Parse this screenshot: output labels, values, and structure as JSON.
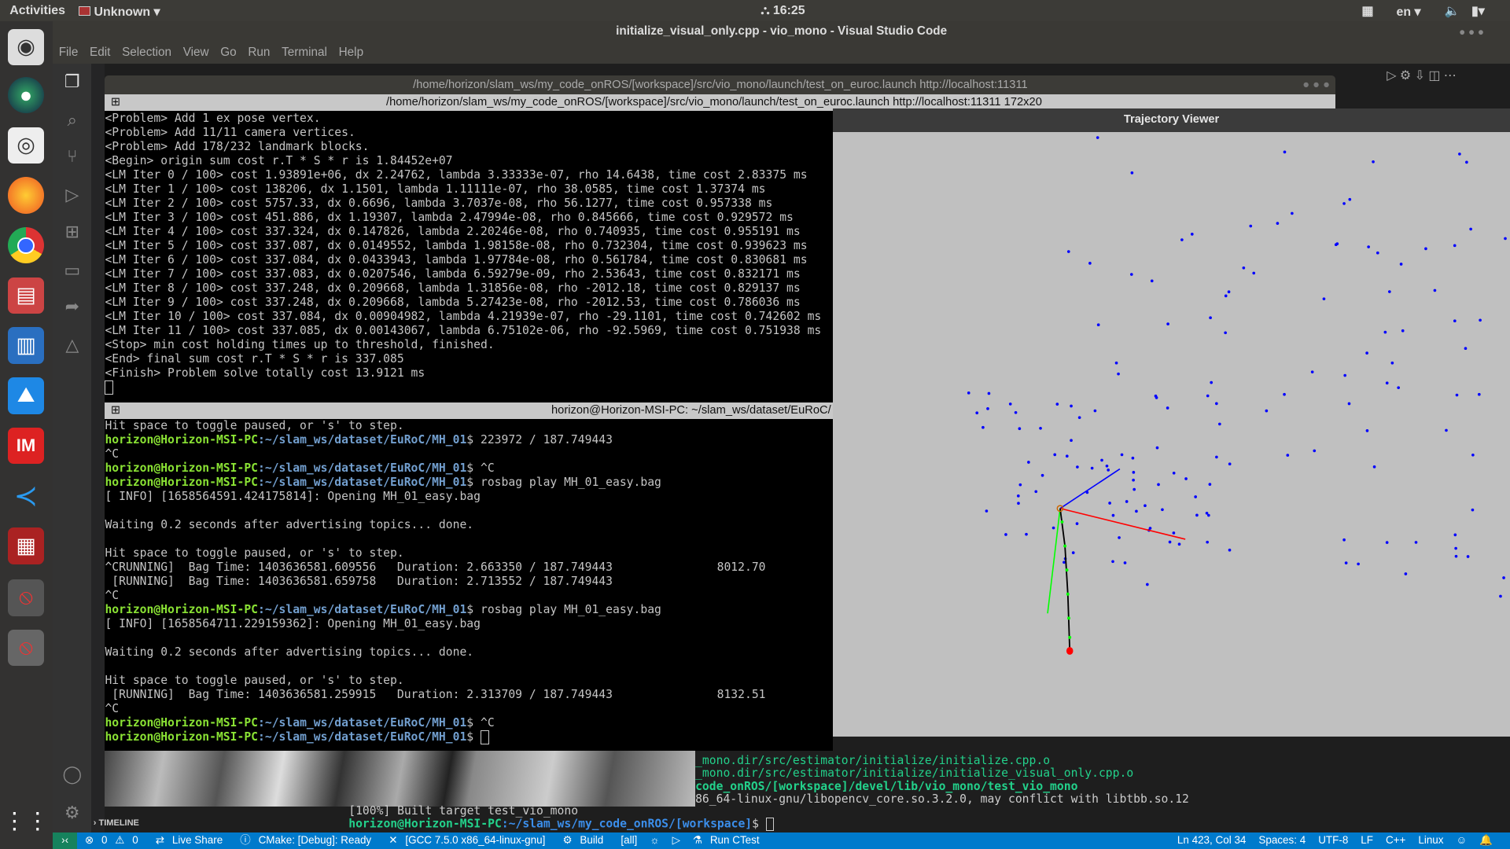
{
  "topbar": {
    "activities": "Activities",
    "app": "Unknown",
    "clock": "16:25",
    "lang": "en"
  },
  "vscode": {
    "title": "initialize_visual_only.cpp - vio_mono - Visual Studio Code",
    "menu": [
      "File",
      "Edit",
      "Selection",
      "View",
      "Go",
      "Run",
      "Terminal",
      "Help"
    ],
    "timeline": "TIMELINE",
    "terminal_lines": [
      {
        "text": "_mono.dir/src/estimator/initialize/initialize.cpp.o",
        "cls": "g"
      },
      {
        "text": "_mono.dir/src/estimator/initialize/initialize_visual_only.cpp.o",
        "cls": "g"
      },
      {
        "text": "code_onROS/[workspace]/devel/lib/vio_mono/test_vio_mono",
        "cls": "gb"
      },
      {
        "text": "86_64-linux-gnu/libopencv_core.so.3.2.0, may conflict with libtbb.so.12",
        "cls": ""
      }
    ],
    "built": "[100%] Built target test_vio_mono",
    "prompt_user": "horizon@Horizon-MSI-PC",
    "prompt_path": ":~/slam_ws/my_code_onROS/[workspace]",
    "prompt_end": "$ "
  },
  "terminator": {
    "window_title": "/home/horizon/slam_ws/my_code_onROS/[workspace]/src/vio_mono/launch/test_on_euroc.launch http://localhost:11311",
    "upper_title": "/home/horizon/slam_ws/my_code_onROS/[workspace]/src/vio_mono/launch/test_on_euroc.launch http://localhost:11311 172x20",
    "lower_title": "horizon@Horizon-MSI-PC: ~/slam_ws/dataset/EuRoC/",
    "upper_lines": [
      "<Problem> Add 1 ex pose vertex.",
      "<Problem> Add 11/11 camera vertices.",
      "<Problem> Add 178/232 landmark blocks.",
      "<Begin> origin sum cost r.T * S * r is 1.84452e+07",
      "<LM Iter 0 / 100> cost 1.93891e+06, dx 2.24762, lambda 3.33333e-07, rho 14.6438, time cost 2.83375 ms",
      "<LM Iter 1 / 100> cost 138206, dx 1.1501, lambda 1.11111e-07, rho 38.0585, time cost 1.37374 ms",
      "<LM Iter 2 / 100> cost 5757.33, dx 0.6696, lambda 3.7037e-08, rho 56.1277, time cost 0.957338 ms",
      "<LM Iter 3 / 100> cost 451.886, dx 1.19307, lambda 2.47994e-08, rho 0.845666, time cost 0.929572 ms",
      "<LM Iter 4 / 100> cost 337.324, dx 0.147826, lambda 2.20246e-08, rho 0.740935, time cost 0.955191 ms",
      "<LM Iter 5 / 100> cost 337.087, dx 0.0149552, lambda 1.98158e-08, rho 0.732304, time cost 0.939623 ms",
      "<LM Iter 6 / 100> cost 337.084, dx 0.0433943, lambda 1.97784e-08, rho 0.561784, time cost 0.830681 ms",
      "<LM Iter 7 / 100> cost 337.083, dx 0.0207546, lambda 6.59279e-09, rho 2.53643, time cost 0.832171 ms",
      "<LM Iter 8 / 100> cost 337.248, dx 0.209668, lambda 1.31856e-08, rho -2012.18, time cost 0.829137 ms",
      "<LM Iter 9 / 100> cost 337.248, dx 0.209668, lambda 5.27423e-08, rho -2012.53, time cost 0.786036 ms",
      "<LM Iter 10 / 100> cost 337.084, dx 0.00904982, lambda 4.21939e-07, rho -29.1101, time cost 0.742602 ms",
      "<LM Iter 11 / 100> cost 337.085, dx 0.00143067, lambda 6.75102e-06, rho -92.5969, time cost 0.751938 ms",
      "<Stop> min cost holding times up to threshold, finished.",
      "<End> final sum cost r.T * S * r is 337.085",
      "<Finish> Problem solve totally cost 13.9121 ms"
    ],
    "lower_lines": [
      {
        "t": "Hit space to toggle paused, or 's' to step."
      },
      {
        "u": "horizon@Horizon-MSI-PC",
        "p": ":~/slam_ws/dataset/EuRoC/MH_01",
        "t": "$ 223972 / 187.749443"
      },
      {
        "t": "^C"
      },
      {
        "u": "horizon@Horizon-MSI-PC",
        "p": ":~/slam_ws/dataset/EuRoC/MH_01",
        "t": "$ ^C"
      },
      {
        "u": "horizon@Horizon-MSI-PC",
        "p": ":~/slam_ws/dataset/EuRoC/MH_01",
        "t": "$ rosbag play MH_01_easy.bag"
      },
      {
        "t": "[ INFO] [1658564591.424175814]: Opening MH_01_easy.bag"
      },
      {
        "t": ""
      },
      {
        "t": "Waiting 0.2 seconds after advertising topics... done."
      },
      {
        "t": ""
      },
      {
        "t": "Hit space to toggle paused, or 's' to step."
      },
      {
        "t": "^CRUNNING]  Bag Time: 1403636581.609556   Duration: 2.663350 / 187.749443               8012.70"
      },
      {
        "t": " [RUNNING]  Bag Time: 1403636581.659758   Duration: 2.713552 / 187.749443"
      },
      {
        "t": "^C"
      },
      {
        "u": "horizon@Horizon-MSI-PC",
        "p": ":~/slam_ws/dataset/EuRoC/MH_01",
        "t": "$ rosbag play MH_01_easy.bag"
      },
      {
        "t": "[ INFO] [1658564711.229159362]: Opening MH_01_easy.bag"
      },
      {
        "t": ""
      },
      {
        "t": "Waiting 0.2 seconds after advertising topics... done."
      },
      {
        "t": ""
      },
      {
        "t": "Hit space to toggle paused, or 's' to step."
      },
      {
        "t": " [RUNNING]  Bag Time: 1403636581.259915   Duration: 2.313709 / 187.749443               8132.51"
      },
      {
        "t": "^C"
      },
      {
        "u": "horizon@Horizon-MSI-PC",
        "p": ":~/slam_ws/dataset/EuRoC/MH_01",
        "t": "$ ^C"
      },
      {
        "u": "horizon@Horizon-MSI-PC",
        "p": ":~/slam_ws/dataset/EuRoC/MH_01",
        "t": "$ "
      }
    ]
  },
  "viewer": {
    "title": "Trajectory Viewer",
    "colors": {
      "landmark": "#0000ff",
      "x_axis": "#ff0000",
      "y_axis": "#00ff00",
      "z_axis": "#0000ff",
      "start": "#ff0000"
    }
  },
  "status": {
    "errors": "0",
    "warnings": "0",
    "live_share": "Live Share",
    "cmake": "CMake: [Debug]: Ready",
    "kit": "[GCC 7.5.0 x86_64-linux-gnu]",
    "build": "Build",
    "target": "[all]",
    "ctest": "Run CTest",
    "position": "Ln 423, Col 34",
    "spaces": "Spaces: 4",
    "encoding": "UTF-8",
    "eol": "LF",
    "language": "C++",
    "os": "Linux"
  }
}
